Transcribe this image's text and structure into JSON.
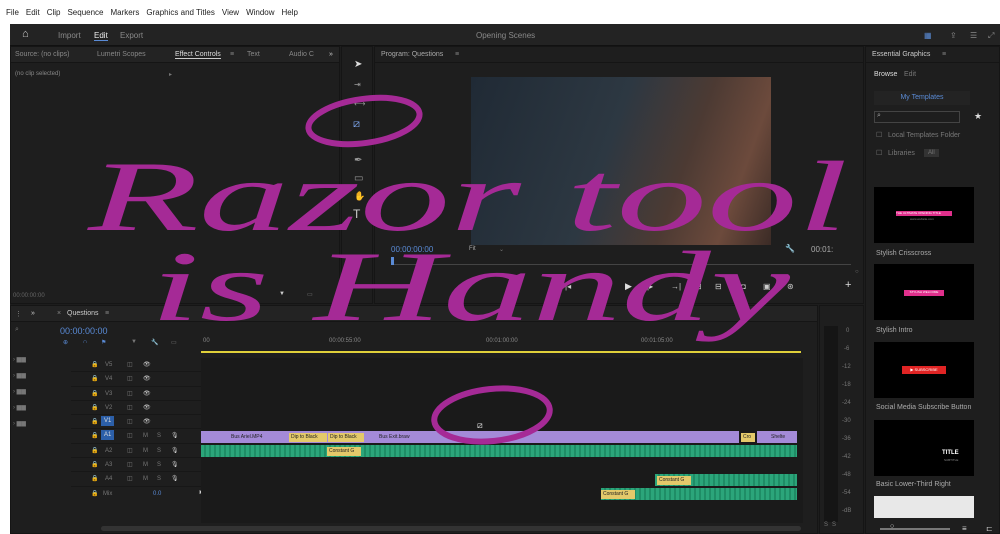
{
  "menu": [
    "File",
    "Edit",
    "Clip",
    "Sequence",
    "Markers",
    "Graphics and Titles",
    "View",
    "Window",
    "Help"
  ],
  "workspace": {
    "tabs": [
      "Import",
      "Edit",
      "Export"
    ],
    "active": "Edit",
    "title": "Opening Scenes"
  },
  "left_tabs": [
    "Source: (no clips)",
    "Lumetri Scopes",
    "Effect Controls",
    "Text",
    "Audio C"
  ],
  "effect_controls": {
    "empty_label": "(no clip selected)",
    "timecode": "00:00:00:00"
  },
  "program": {
    "title": "Program: Questions",
    "timecode": "00:00:00:00",
    "fit": "Fit",
    "end_tc": "00:01:"
  },
  "timeline": {
    "tab": "Questions",
    "timecode": "00:00:00:00",
    "ruler": [
      "00",
      "00:00:55:00",
      "00:01:00:00",
      "00:01:05:00"
    ],
    "video_tracks": [
      "V5",
      "V4",
      "V3",
      "V2",
      "V1"
    ],
    "audio_tracks": [
      "A1",
      "A2",
      "A3",
      "A4"
    ],
    "mix_label": "Mix",
    "mix_value": "0.0",
    "clips": {
      "v1a": "Bus Ariel.MP4",
      "v1b": "Dip to Black",
      "v1c": "Dip to Black",
      "v1d": "Bus Exit.braw",
      "v1e": "Shelte",
      "v1f": "Cro",
      "a1": "Constant G",
      "a3": "Constant G",
      "a4": "Constant G"
    }
  },
  "meter": [
    "0",
    "-6",
    "-12",
    "-18",
    "-24",
    "-30",
    "-36",
    "-42",
    "-48",
    "-54",
    "-dB"
  ],
  "meter_labels": [
    "S",
    "S"
  ],
  "essential": {
    "title": "Essential Graphics",
    "tabs": [
      "Browse",
      "Edit"
    ],
    "my_templates": "My Templates",
    "local": "Local Templates Folder",
    "libraries": "Libraries",
    "library_value": "All",
    "templates": [
      {
        "name": "Stylish Crisscross",
        "thumb": "THE ULTIMATE OPENING TITLE",
        "thumb_sub": "www.website.com"
      },
      {
        "name": "Stylish Intro",
        "thumb": "STYLISH WELCOME"
      },
      {
        "name": "Social Media Subscribe Button",
        "thumb": "▶ SUBSCRIBE"
      },
      {
        "name": "Basic Lower-Third Right",
        "thumb": "TITLE",
        "thumb_sub": "SUBTITLE"
      }
    ]
  },
  "annotation": {
    "line1": "Razor tool",
    "line2": "is Handy"
  },
  "colors": {
    "accent": "#5a8bd6",
    "violet": "#a48ad8",
    "green": "#2ba57a",
    "ink": "#a52a96"
  }
}
